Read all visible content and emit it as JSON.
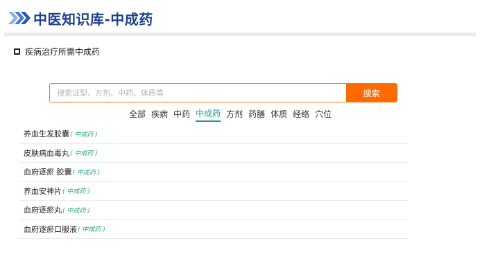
{
  "header": {
    "title": "中医知识库-中成药",
    "logo_icon": "chevron-right-double-icon",
    "colors": {
      "title": "#1d3f8f",
      "chevron_light": "#8fb0e6",
      "chevron_dark": "#2a56b8"
    }
  },
  "section": {
    "title": "疾病治疗所需中成药"
  },
  "search": {
    "placeholder": "搜索证型、方剂、中药、体质等",
    "value": "",
    "button_label": "搜索",
    "button_color": "#ff6a00"
  },
  "categories": {
    "items": [
      "全部",
      "疾病",
      "中药",
      "中成药",
      "方剂",
      "药膳",
      "体质",
      "经络",
      "穴位"
    ],
    "active": "中成药",
    "active_color": "#1e9e84"
  },
  "results": [
    {
      "name": "养血生发胶囊",
      "type": "( 中成药 )"
    },
    {
      "name": "皮肤病血毒丸",
      "type": "( 中成药 )"
    },
    {
      "name": "血府逐瘀 胶囊",
      "type": "( 中成药 )"
    },
    {
      "name": "养血安神片",
      "type": "( 中成药 )"
    },
    {
      "name": "血府逐瘀丸",
      "type": "( 中成药 )"
    },
    {
      "name": "血府逐瘀口服液",
      "type": "( 中成药 )"
    }
  ]
}
